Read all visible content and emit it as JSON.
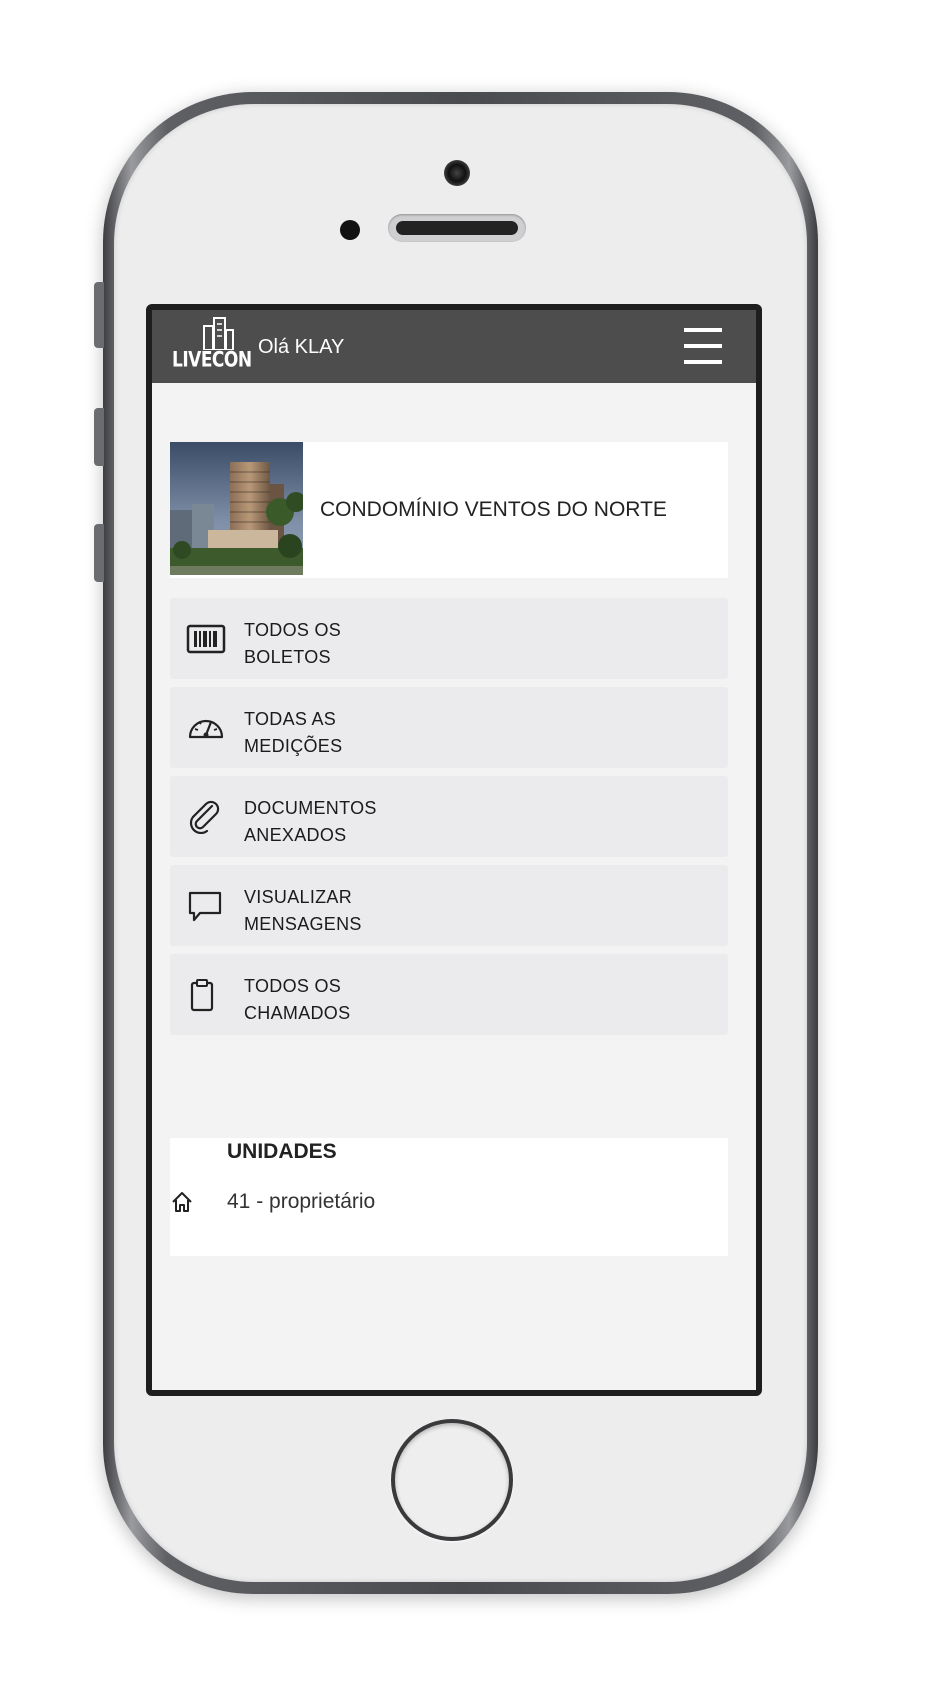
{
  "app": {
    "logo_text": "LIVECON",
    "greeting": "Olá KLAY"
  },
  "building": {
    "name": "CONDOMÍNIO VENTOS DO NORTE"
  },
  "menu": [
    {
      "line1": "TODOS OS",
      "line2": "BOLETOS",
      "icon": "barcode-icon"
    },
    {
      "line1": "TODAS AS",
      "line2": "MEDIÇÕES",
      "icon": "gauge-icon"
    },
    {
      "line1": "DOCUMENTOS",
      "line2": "ANEXADOS",
      "icon": "paperclip-icon"
    },
    {
      "line1": "VISUALIZAR",
      "line2": "MENSAGENS",
      "icon": "chat-bubble-icon"
    },
    {
      "line1": "TODOS OS",
      "line2": "CHAMADOS",
      "icon": "clipboard-icon"
    }
  ],
  "units": {
    "title": "UNIDADES",
    "items": [
      {
        "label": "41 - proprietário",
        "icon": "home-icon"
      }
    ]
  },
  "colors": {
    "app_bar": "#4d4d4d",
    "screen_bg": "#f3f3f3",
    "menu_item_bg": "#ebebed",
    "card_bg": "#ffffff"
  }
}
